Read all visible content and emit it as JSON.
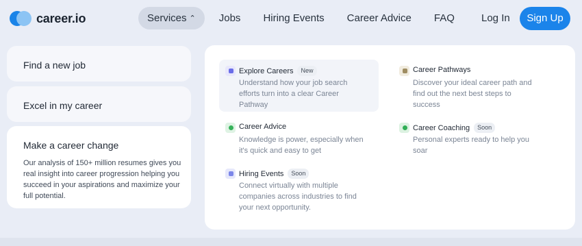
{
  "brand": {
    "name": "career.io",
    "colors": {
      "primary": "#1a84e8",
      "secondary": "#8cc4f4"
    }
  },
  "nav": {
    "items": [
      {
        "label": "Services",
        "active": true,
        "icon": "chevron-up-icon",
        "glyph": "⌃"
      },
      {
        "label": "Jobs"
      },
      {
        "label": "Hiring Events"
      },
      {
        "label": "Career Advice"
      },
      {
        "label": "FAQ"
      }
    ],
    "login_label": "Log In",
    "signup_label": "Sign Up"
  },
  "left": {
    "cards": [
      {
        "title": "Find a new job"
      },
      {
        "title": "Excel in my career"
      },
      {
        "title": "Make a career change",
        "description": "Our analysis of 150+ million resumes gives you real insight into career progression helping you succeed in your aspirations and maximize your full potential."
      }
    ]
  },
  "panel": {
    "items": [
      {
        "title": "Explore Careers",
        "badge": "New",
        "description": "Understand how your job search efforts turn into a clear Career Pathway",
        "icon": "explore-careers-icon"
      },
      {
        "title": "Career Pathways",
        "description": "Discover your ideal career path and find out the next best steps to success",
        "icon": "career-pathways-icon"
      },
      {
        "title": "Career Advice",
        "description": "Knowledge is power, especially when it's quick and easy to get",
        "icon": "career-advice-icon"
      },
      {
        "title": "Career Coaching",
        "badge": "Soon",
        "description": "Personal experts ready to help you soar",
        "icon": "career-coaching-icon"
      },
      {
        "title": "Hiring Events",
        "badge": "Soon",
        "description": "Connect virtually with multiple companies across industries to find your next opportunity.",
        "icon": "hiring-events-icon"
      }
    ]
  }
}
